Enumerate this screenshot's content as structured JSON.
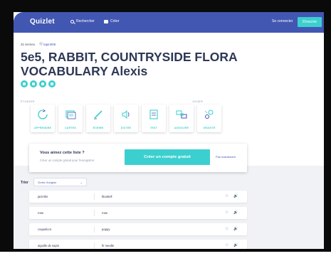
{
  "header": {
    "logo": "Quizlet",
    "search_label": "Rechercher",
    "create_label": "Créer",
    "login_label": "Se connecter",
    "signup_label": "S'inscrire"
  },
  "breadcrumb": {
    "count": "31 termes",
    "author": "lapin005"
  },
  "set_title": "5e5, RABBIT, COUNTRYSIDE FLORA VOCABULARY Alexis",
  "sections": {
    "study": "ÉTUDIER",
    "play": "JOUER"
  },
  "modes": [
    {
      "label": "APPRENDRE",
      "icon": "learn-icon"
    },
    {
      "label": "CARTES",
      "icon": "flashcards-icon"
    },
    {
      "label": "ÉCRIRE",
      "icon": "write-icon"
    },
    {
      "label": "DICTÉE",
      "icon": "spell-icon"
    },
    {
      "label": "TEST",
      "icon": "test-icon"
    },
    {
      "label": "ASSOCIER",
      "icon": "match-icon"
    },
    {
      "label": "GRAVITÉ",
      "icon": "gravity-icon"
    }
  ],
  "cta": {
    "question": "Vous aimez cette liste ?",
    "subtitle": "Créer un compte gratuit pour l'enregistrer.",
    "button": "Créer un compte gratuit",
    "link": "Pas maintenant"
  },
  "sort": {
    "label": "Trier",
    "selected": "Ordre d'origine"
  },
  "terms": [
    {
      "term": "jacinthe",
      "definition": "bluebell"
    },
    {
      "term": "rose",
      "definition": "rose"
    },
    {
      "term": "coquelicot",
      "definition": "poppy"
    },
    {
      "term": "aiguille de sapin",
      "definition": "fir needle"
    }
  ],
  "colors": {
    "brand_blue": "#4257b2",
    "accent_teal": "#3ccfcf",
    "page_grey": "#f0f2f5",
    "title_text": "#2e3856"
  }
}
